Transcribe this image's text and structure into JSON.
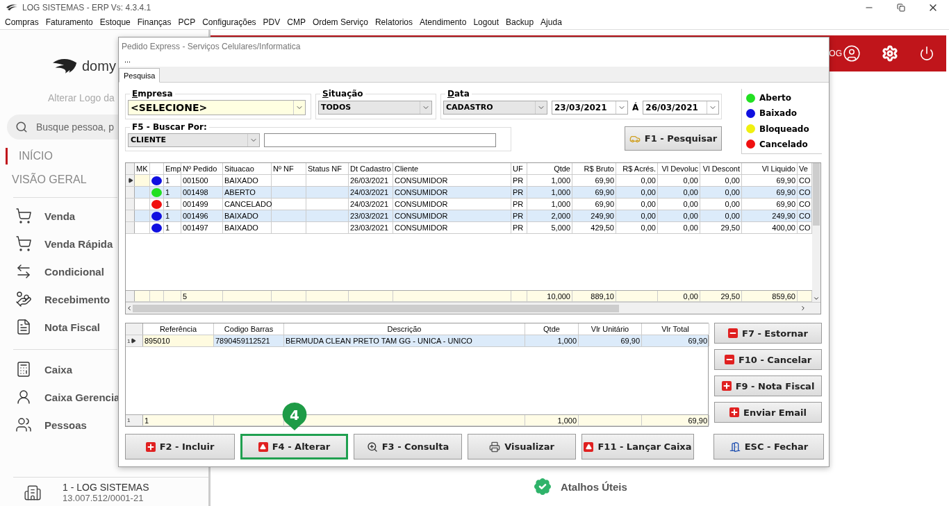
{
  "window": {
    "title": "LOG SISTEMAS - ERP Vs: 4.3.4.1"
  },
  "menu": [
    "Compras",
    "Faturamento",
    "Estoque",
    "Finanças",
    "PCP",
    "Configurações",
    "PDV",
    "CMP",
    "Ordem Serviço",
    "Relatorios",
    "Atendimento",
    "Logout",
    "Backup",
    "Ajuda"
  ],
  "sidebar": {
    "logo_text": "domy",
    "logo_caption": "Alterar Logo da",
    "search": {
      "placeholder": "Busque pessoa, p"
    },
    "sections": [
      {
        "label": "INÍCIO",
        "selected": true
      },
      {
        "label": "VISÃO GERAL",
        "selected": false
      }
    ],
    "groups": [
      [
        {
          "label": "Venda",
          "kind": "cart"
        },
        {
          "label": "Venda Rápida",
          "kind": "cart"
        },
        {
          "label": "Condicional",
          "kind": "exchange"
        },
        {
          "label": "Recebimento",
          "kind": "money"
        },
        {
          "label": "Nota Fiscal",
          "kind": "invoice"
        }
      ],
      [
        {
          "label": "Caixa",
          "kind": "register"
        },
        {
          "label": "Caixa Gerencia",
          "kind": "user-money"
        },
        {
          "label": "Pessoas",
          "kind": "people"
        }
      ]
    ],
    "company": {
      "name": "1 - LOG SISTEMAS",
      "document": "13.007.512/0001-21"
    }
  },
  "header": {
    "user_text": "OG"
  },
  "shortcuts": {
    "label": "Atalhos Úteis"
  },
  "dialog": {
    "title": "Pedido Express - Serviços Celulares/Informatica",
    "menu_text": "...",
    "tabs": [
      {
        "label": "Pesquisa",
        "selected": true
      }
    ],
    "filters": {
      "empresa": {
        "label": "Empresa",
        "value": "<SELECIONE>"
      },
      "situacao": {
        "label": "Situação",
        "value": "TODOS"
      },
      "data": {
        "label": "Data",
        "type": "CADASTRO",
        "from": "23/03/2021",
        "separator": "Á",
        "to": "26/03/2021"
      },
      "buscar": {
        "label": "F5 - Buscar Por:",
        "field": "CLIENTE"
      }
    },
    "search_button": {
      "label": "F1 - Pesquisar",
      "kind": "car"
    },
    "legend": [
      {
        "label": "Aberto",
        "color": "#22e022"
      },
      {
        "label": "Baixado",
        "color": "#1010e0"
      },
      {
        "label": "Bloqueado",
        "color": "#f0f010"
      },
      {
        "label": "Cancelado",
        "color": "#f01010"
      }
    ],
    "orders": {
      "columns": [
        {
          "kind": "text",
          "label": "MK"
        },
        {
          "kind": "status"
        },
        {
          "kind": "text",
          "label": "Emp"
        },
        {
          "kind": "text",
          "label": "Nº Pedido"
        },
        {
          "kind": "text",
          "label": "Situacao"
        },
        {
          "kind": "text",
          "label": "Nº NF"
        },
        {
          "kind": "text",
          "label": "Status NF"
        },
        {
          "kind": "text",
          "label": "Dt Cadastro"
        },
        {
          "kind": "text",
          "label": "Cliente"
        },
        {
          "kind": "text",
          "label": "UF"
        },
        {
          "kind": "number",
          "label": "Qtde"
        },
        {
          "kind": "number",
          "label": "R$ Bruto"
        },
        {
          "kind": "number",
          "label": "R$ Acrés."
        },
        {
          "kind": "number",
          "label": "Vl Devoluc"
        },
        {
          "kind": "number",
          "label": "Vl Descont"
        },
        {
          "kind": "number",
          "label": "Vl Liquido"
        },
        {
          "kind": "text",
          "label": "Ve"
        }
      ],
      "rows": [
        {
          "selected": true,
          "color": "#1010e0",
          "emp": "1",
          "pedido": "001500",
          "situacao": "BAIXADO",
          "dt_cadastro": "26/03/2021",
          "cliente": "CONSUMIDOR",
          "uf": "PR",
          "qtde": "1,000",
          "bruto": "69,90",
          "acres": "0,00",
          "devoluc": "0,00",
          "descont": "0,00",
          "liquido": "69,90",
          "column_17": "CO"
        },
        {
          "selected": false,
          "color": "#22e022",
          "emp": "1",
          "pedido": "001498",
          "situacao": "ABERTO",
          "dt_cadastro": "24/03/2021",
          "cliente": "CONSUMIDOR",
          "uf": "PR",
          "qtde": "1,000",
          "bruto": "69,90",
          "acres": "0,00",
          "devoluc": "0,00",
          "descont": "0,00",
          "liquido": "69,90",
          "column_17": "CO"
        },
        {
          "selected": false,
          "color": "#f01010",
          "emp": "1",
          "pedido": "001499",
          "situacao": "CANCELADO",
          "dt_cadastro": "24/03/2021",
          "cliente": "CONSUMIDOR",
          "uf": "PR",
          "qtde": "1,000",
          "bruto": "69,90",
          "acres": "0,00",
          "devoluc": "0,00",
          "descont": "0,00",
          "liquido": "69,90",
          "column_17": "CO"
        },
        {
          "selected": false,
          "color": "#1010e0",
          "emp": "1",
          "pedido": "001496",
          "situacao": "BAIXADO",
          "dt_cadastro": "23/03/2021",
          "cliente": "CONSUMIDOR",
          "uf": "PR",
          "qtde": "2,000",
          "bruto": "249,90",
          "acres": "0,00",
          "devoluc": "0,00",
          "descont": "0,00",
          "liquido": "249,90",
          "column_17": "CO"
        },
        {
          "selected": false,
          "color": "#1010e0",
          "emp": "1",
          "pedido": "001497",
          "situacao": "BAIXADO",
          "dt_cadastro": "23/03/2021",
          "cliente": "CONSUMIDOR",
          "uf": "PR",
          "qtde": "5,000",
          "bruto": "429,50",
          "acres": "0,00",
          "devoluc": "0,00",
          "descont": "29,50",
          "liquido": "400,00",
          "column_17": "CO"
        }
      ],
      "totals": {
        "pedido": "5",
        "qtde": "10,000",
        "bruto": "889,10",
        "devoluc": "0,00",
        "descont": "29,50",
        "liquido": "859,60"
      }
    },
    "items": {
      "columns": [
        "Referência",
        "Codigo Barras",
        "Descrição",
        "Qtde",
        "Vlr Unitário",
        "Vlr Total"
      ],
      "rows": [
        {
          "row_number": "1",
          "selected": true,
          "referencia": "895010",
          "codigo_barras": "7890459112521",
          "descricao": "BERMUDA CLEAN PRETO TAM  GG - UNICA - UNICO",
          "qtde": "1,000",
          "vlr_unitario": "69,90",
          "vlr_total": "69,90"
        }
      ],
      "totals": {
        "row_number": "1",
        "referencia": "1",
        "qtde": "1,000",
        "vlr_total": "69,90"
      }
    },
    "side_buttons": [
      {
        "label": "F7 - Estornar",
        "kind": "minus"
      },
      {
        "label": "F10 - Cancelar",
        "kind": "minus"
      },
      {
        "label": "F9 - Nota Fiscal",
        "kind": "plus"
      },
      {
        "label": "Enviar Email",
        "kind": "plus"
      }
    ],
    "buttons": [
      {
        "label": "F2 - Incluir",
        "kind": "plus",
        "highlighted": false
      },
      {
        "label": "F4 - Alterar",
        "kind": "up",
        "highlighted": true,
        "callout": "4"
      },
      {
        "label": "F3 - Consulta",
        "kind": "zoom",
        "highlighted": false
      },
      {
        "label": "Visualizar",
        "kind": "printer",
        "highlighted": false
      },
      {
        "label": "F11 - Lançar Caixa",
        "kind": "up",
        "highlighted": false
      }
    ],
    "close_button": {
      "label": "ESC - Fechar",
      "kind": "door"
    }
  }
}
